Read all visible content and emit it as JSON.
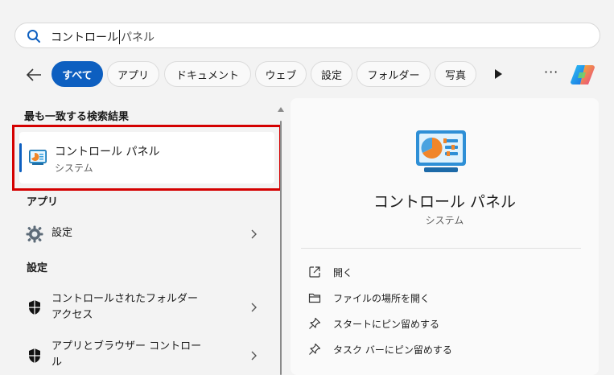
{
  "search": {
    "typed": "コントロール",
    "rest": "パネル"
  },
  "filters": {
    "chips": [
      "すべて",
      "アプリ",
      "ドキュメント",
      "ウェブ",
      "設定",
      "フォルダー",
      "写真"
    ],
    "more_label": "···"
  },
  "best_match": {
    "heading": "最も一致する検索結果",
    "title": "コントロール パネル",
    "subtitle": "システム"
  },
  "apps": {
    "heading": "アプリ",
    "items": [
      {
        "label": "設定"
      }
    ]
  },
  "settings": {
    "heading": "設定",
    "items": [
      {
        "line1": "コントロールされたフォルダー",
        "line2": "アクセス"
      },
      {
        "line1": "アプリとブラウザー コントロー",
        "line2": "ル"
      }
    ]
  },
  "detail": {
    "title": "コントロール パネル",
    "subtitle": "システム",
    "actions": [
      {
        "label": "開く",
        "icon": "open-external-icon"
      },
      {
        "label": "ファイルの場所を開く",
        "icon": "folder-icon"
      },
      {
        "label": "スタートにピン留めする",
        "icon": "pin-icon"
      },
      {
        "label": "タスク バーにピン留めする",
        "icon": "pin-icon"
      }
    ]
  },
  "colors": {
    "accent": "#0d5fc0",
    "highlight_border": "#d40000",
    "background": "#f3f3f3"
  }
}
